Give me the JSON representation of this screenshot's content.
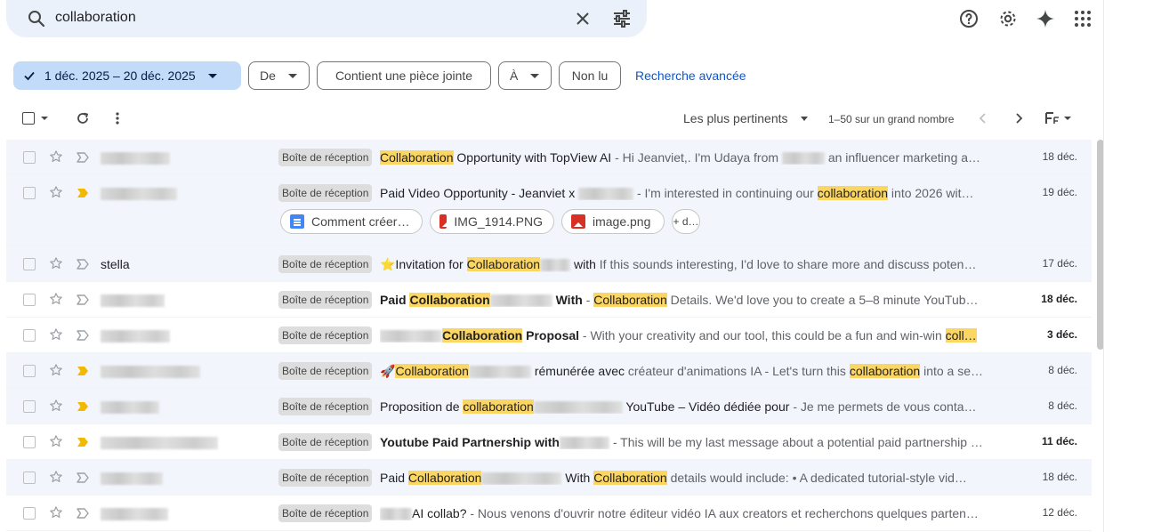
{
  "search": {
    "query": "collaboration"
  },
  "top_icons": [
    "help-icon",
    "settings-icon",
    "gemini-spark-icon",
    "apps-grid-icon"
  ],
  "filters": {
    "date_range": "1 déc. 2025 – 20 déc. 2025",
    "from": "De",
    "has_attachment": "Contient une pièce jointe",
    "to": "À",
    "unread": "Non lu",
    "advanced": "Recherche avancée"
  },
  "toolbar": {
    "sort": "Les plus pertinents",
    "range": "1–50 sur un grand nombre"
  },
  "colors": {
    "highlight": "#fcd663",
    "label_bg": "#dddddd",
    "important": "#f2b900",
    "link": "#0b57d0"
  },
  "emails": [
    {
      "sender": "",
      "label": "Boîte de réception",
      "subject_parts": [
        "",
        "Collaboration",
        " Opportunity with TopView AI"
      ],
      "snippet_parts": [
        " - Hi Jeanviet,. I'm Udaya from ",
        "",
        "",
        " an influencer marketing a…"
      ],
      "date": "18 déc.",
      "bold": false,
      "important": false
    },
    {
      "sender": "",
      "label": "Boîte de réception",
      "subject_parts": [
        "Paid Video Opportunity - Jeanviet x ",
        "",
        ""
      ],
      "snippet_parts": [
        " - I'm interested in continuing our ",
        "collaboration",
        " into 2026 wit…",
        ""
      ],
      "date": "19 déc.",
      "bold": false,
      "important": true,
      "attachments": [
        "Comment créer…",
        "IMG_1914.PNG",
        "image.png",
        "+ d…"
      ]
    },
    {
      "sender": "stella",
      "label": "Boîte de réception",
      "subject_parts": [
        "⭐Invitation for ",
        "Collaboration",
        " with"
      ],
      "snippet_parts": [
        "  If this sounds interesting, I'd love to share more and discuss poten…",
        "",
        "",
        ""
      ],
      "date": "17 déc.",
      "bold": false,
      "important": false
    },
    {
      "sender": "",
      "label": "Boîte de réception",
      "subject_parts": [
        "Paid ",
        "Collaboration",
        " With "
      ],
      "snippet_parts": [
        " - ",
        "Collaboration",
        " Details. We'd love you to create a 5–8 minute YouTub…",
        ""
      ],
      "date": "18 déc.",
      "bold": true,
      "important": false
    },
    {
      "sender": "",
      "label": "Boîte de réception",
      "subject_parts": [
        "",
        "Collaboration",
        " Proposal"
      ],
      "snippet_parts": [
        " - With your creativity and our tool, this could be a fun and win-win ",
        "coll…",
        "",
        ""
      ],
      "date": "3 déc.",
      "bold": true,
      "important": false
    },
    {
      "sender": "",
      "label": "Boîte de réception",
      "subject_parts": [
        "🚀",
        "Collaboration",
        " rémunérée avec "
      ],
      "snippet_parts": [
        "créateur d'animations IA - Let's turn this ",
        "collaboration",
        " into a se…",
        ""
      ],
      "date": "8 déc.",
      "bold": false,
      "important": true
    },
    {
      "sender": "",
      "label": "Boîte de réception",
      "subject_parts": [
        "Proposition de ",
        "collaboration",
        " YouTube – Vidéo dédiée pour "
      ],
      "snippet_parts": [
        " - Je me permets de vous conta…",
        "",
        "",
        ""
      ],
      "date": "8 déc.",
      "bold": false,
      "important": true
    },
    {
      "sender": "",
      "label": "Boîte de réception",
      "subject_parts": [
        "Youtube Paid Partnership with",
        "",
        ""
      ],
      "snippet_parts": [
        " - This will be my last message about a potential paid partnership …",
        "",
        "",
        ""
      ],
      "date": "11 déc.",
      "bold": true,
      "important": true
    },
    {
      "sender": "",
      "label": "Boîte de réception",
      "subject_parts": [
        "Paid ",
        "Collaboration",
        " With "
      ],
      "snippet_parts": [
        "  ",
        "Collaboration",
        " details would include: • A dedicated tutorial-style vid…",
        ""
      ],
      "date": "18 déc.",
      "bold": false,
      "important": false
    },
    {
      "sender": "",
      "label": "Boîte de réception",
      "subject_parts": [
        "AI collab?",
        "",
        ""
      ],
      "snippet_parts": [
        " - Nous venons d'ouvrir notre éditeur vidéo IA aux creators et recherchons quelques parten…",
        "",
        "",
        ""
      ],
      "date": "12 déc.",
      "bold": false,
      "important": false
    }
  ]
}
